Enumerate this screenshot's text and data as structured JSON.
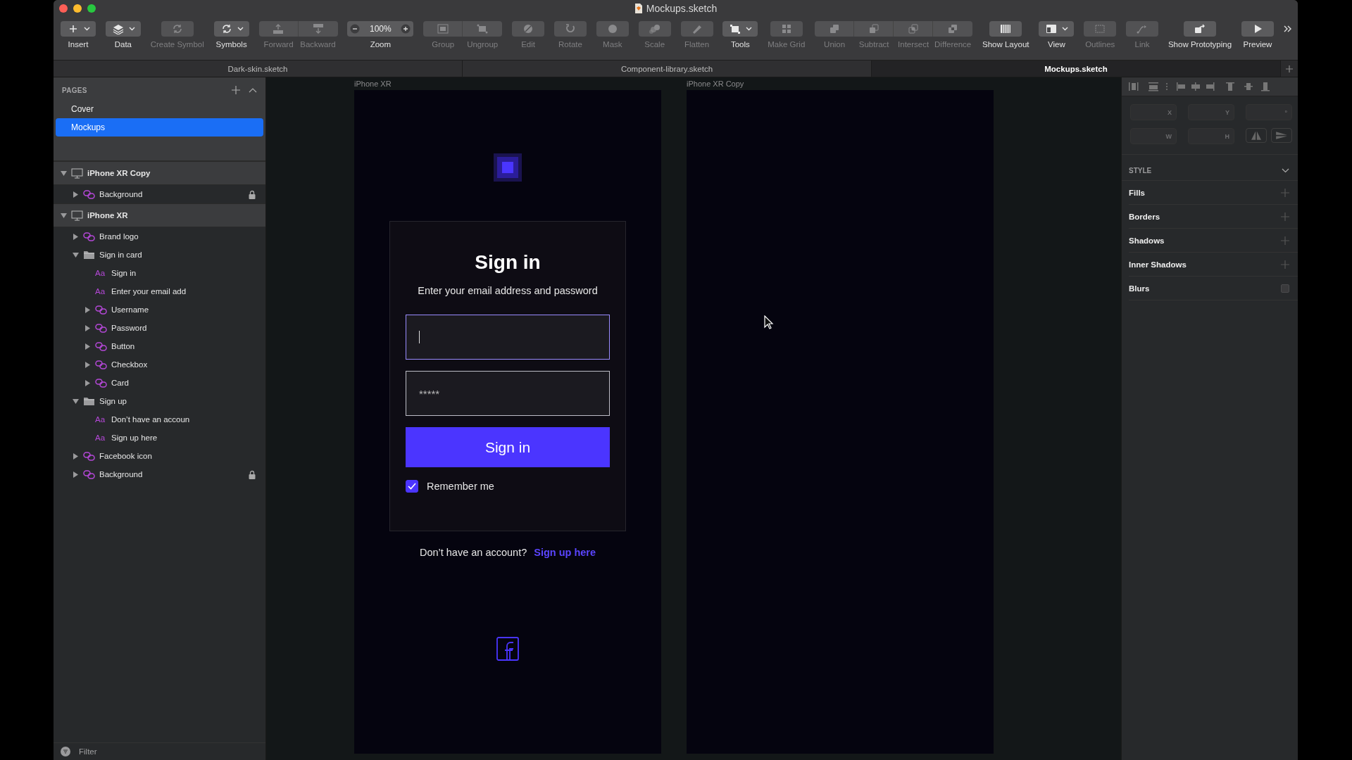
{
  "window": {
    "title": "Mockups.sketch"
  },
  "toolbar": [
    {
      "items": [
        {
          "kind": "tool",
          "label": "Insert",
          "dropdown": true,
          "disabled": false
        }
      ]
    },
    {
      "items": [
        {
          "kind": "tool",
          "label": "Data",
          "dropdown": true,
          "disabled": false
        }
      ]
    },
    {
      "items": [
        {
          "kind": "tool",
          "label": "Create Symbol",
          "dropdown": false,
          "disabled": true
        }
      ]
    },
    {
      "items": [
        {
          "kind": "tool",
          "label": "Symbols",
          "dropdown": true,
          "disabled": false
        }
      ]
    },
    {
      "items": [
        {
          "kind": "tool",
          "label": "Forward",
          "dropdown": false,
          "disabled": true
        },
        {
          "kind": "tool",
          "label": "Backward",
          "dropdown": false,
          "disabled": true
        }
      ]
    },
    {
      "items": [
        {
          "kind": "zoom",
          "label": "Zoom",
          "value": "100%"
        }
      ]
    },
    {
      "items": [
        {
          "kind": "tool",
          "label": "Group",
          "dropdown": false,
          "disabled": true
        },
        {
          "kind": "tool",
          "label": "Ungroup",
          "dropdown": false,
          "disabled": true
        }
      ]
    },
    {
      "items": [
        {
          "kind": "tool",
          "label": "Edit",
          "dropdown": false,
          "disabled": true
        }
      ]
    },
    {
      "items": [
        {
          "kind": "tool",
          "label": "Rotate",
          "dropdown": false,
          "disabled": true
        }
      ]
    },
    {
      "items": [
        {
          "kind": "tool",
          "label": "Mask",
          "dropdown": false,
          "disabled": true
        }
      ]
    },
    {
      "items": [
        {
          "kind": "tool",
          "label": "Scale",
          "dropdown": false,
          "disabled": true
        }
      ]
    },
    {
      "items": [
        {
          "kind": "tool",
          "label": "Flatten",
          "dropdown": false,
          "disabled": true
        }
      ]
    },
    {
      "items": [
        {
          "kind": "tool",
          "label": "Tools",
          "dropdown": true,
          "disabled": false
        }
      ]
    },
    {
      "items": [
        {
          "kind": "tool",
          "label": "Make Grid",
          "dropdown": false,
          "disabled": true
        }
      ]
    },
    {
      "items": [
        {
          "kind": "tool",
          "label": "Union",
          "dropdown": false,
          "disabled": true
        },
        {
          "kind": "tool",
          "label": "Subtract",
          "dropdown": false,
          "disabled": true
        },
        {
          "kind": "tool",
          "label": "Intersect",
          "dropdown": false,
          "disabled": true
        },
        {
          "kind": "tool",
          "label": "Difference",
          "dropdown": false,
          "disabled": true
        }
      ]
    },
    {
      "items": [
        {
          "kind": "tool",
          "label": "Show Layout",
          "dropdown": false,
          "disabled": false
        }
      ]
    },
    {
      "items": [
        {
          "kind": "tool",
          "label": "View",
          "dropdown": true,
          "disabled": false
        }
      ]
    },
    {
      "items": [
        {
          "kind": "tool",
          "label": "Outlines",
          "dropdown": false,
          "disabled": true
        }
      ]
    },
    {
      "items": [
        {
          "kind": "tool",
          "label": "Link",
          "dropdown": false,
          "disabled": true
        }
      ]
    },
    {
      "items": [
        {
          "kind": "tool",
          "label": "Show Prototyping",
          "dropdown": false,
          "disabled": false
        }
      ]
    },
    {
      "items": [
        {
          "kind": "tool",
          "label": "Preview",
          "dropdown": false,
          "disabled": false
        }
      ]
    }
  ],
  "document_tabs": [
    {
      "label": "Dark-skin.sketch",
      "selected": false
    },
    {
      "label": "Component-library.sketch",
      "selected": false
    },
    {
      "label": "Mockups.sketch",
      "selected": true
    }
  ],
  "pages": {
    "title": "PAGES",
    "items": [
      {
        "label": "Cover",
        "selected": false
      },
      {
        "label": "Mockups",
        "selected": true
      }
    ]
  },
  "layers": [
    {
      "kind": "artboard",
      "label": "iPhone XR Copy",
      "expanded": true,
      "children": [
        {
          "kind": "symbol",
          "label": "Background",
          "expanded": false,
          "locked": true
        }
      ]
    },
    {
      "kind": "artboard",
      "label": "iPhone XR",
      "expanded": true,
      "children": [
        {
          "kind": "symbol",
          "label": "Brand logo",
          "expanded": false,
          "locked": false
        },
        {
          "kind": "group",
          "label": "Sign in card",
          "expanded": true,
          "locked": false,
          "children": [
            {
              "kind": "text",
              "glyph": "Aa",
              "label": "Sign in",
              "locked": false
            },
            {
              "kind": "text",
              "glyph": "Aa",
              "label": "Enter your email add",
              "locked": false
            },
            {
              "kind": "symbol",
              "label": "Username",
              "expanded": false,
              "locked": false
            },
            {
              "kind": "symbol",
              "label": "Password",
              "expanded": false,
              "locked": false
            },
            {
              "kind": "symbol",
              "label": "Button",
              "expanded": false,
              "locked": false
            },
            {
              "kind": "symbol",
              "label": "Checkbox",
              "expanded": false,
              "locked": false
            },
            {
              "kind": "symbol",
              "label": "Card",
              "expanded": false,
              "locked": false
            }
          ]
        },
        {
          "kind": "group",
          "label": "Sign up",
          "expanded": true,
          "locked": false,
          "children": [
            {
              "kind": "text",
              "glyph": "Aa",
              "label": "Don’t have an accoun",
              "locked": false
            },
            {
              "kind": "text",
              "glyph": "Aa",
              "label": "Sign up here",
              "locked": false
            }
          ]
        },
        {
          "kind": "symbol",
          "label": "Facebook icon",
          "expanded": false,
          "locked": false
        },
        {
          "kind": "symbol",
          "label": "Background",
          "expanded": false,
          "locked": true
        }
      ]
    }
  ],
  "filter": {
    "placeholder": "Filter"
  },
  "inspector": {
    "fields": [
      {
        "suffix": "X"
      },
      {
        "suffix": "Y"
      },
      {
        "suffix": "°"
      },
      {
        "suffix": "W"
      },
      {
        "suffix": "H"
      }
    ],
    "style_title": "STYLE",
    "sections": [
      {
        "kind": "add",
        "label": "Fills"
      },
      {
        "kind": "add",
        "label": "Borders"
      },
      {
        "kind": "add",
        "label": "Shadows"
      },
      {
        "kind": "add",
        "label": "Inner Shadows"
      },
      {
        "kind": "toggle",
        "label": "Blurs",
        "checked": false
      }
    ]
  },
  "artboards": [
    {
      "title": "iPhone XR",
      "kind": "signin",
      "card": {
        "title": "Sign in",
        "subtitle": "Enter your email address and password",
        "username": {
          "focused": true
        },
        "password": {
          "value": "*****",
          "focused": false
        },
        "button": "Sign in",
        "remember": {
          "label": "Remember me",
          "checked": true
        }
      },
      "signup": {
        "text": "Don’t have an account?",
        "link": "Sign up here"
      }
    },
    {
      "title": "iPhone XR Copy",
      "kind": "empty"
    }
  ]
}
